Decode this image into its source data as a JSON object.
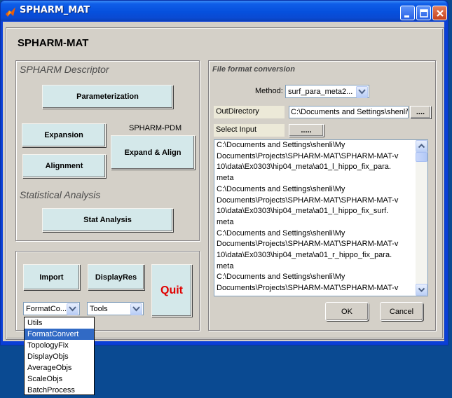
{
  "window": {
    "title": "SPHARM_MAT"
  },
  "main_title": "SPHARM-MAT",
  "descriptor_panel": {
    "title": "SPHARM Descriptor",
    "parameterization": "Parameterization",
    "expansion": "Expansion",
    "alignment": "Alignment",
    "pdm_label": "SPHARM-PDM",
    "expand_align": "Expand & Align",
    "stat_title": "Statistical Analysis",
    "stat_analysis": "Stat Analysis"
  },
  "bottom_panel": {
    "import": "Import",
    "display_res": "DisplayRes",
    "quit": "Quit",
    "combo1_value": "FormatCo...",
    "combo2_value": "Tools"
  },
  "dropdown": {
    "items": [
      "Utils",
      "FormatConvert",
      "TopologyFix",
      "DisplayObjs",
      "AverageObjs",
      "ScaleObjs",
      "BatchProcess"
    ],
    "selected": "FormatConvert"
  },
  "format_panel": {
    "title": "File format conversion",
    "method_label": "Method:",
    "method_value": "surf_para_meta2...",
    "outdir_label": "OutDirectory",
    "outdir_value": "C:\\Documents and Settings\\shenli\\M",
    "browse_label": "....",
    "select_input_label": "Select Input",
    "select_input_button": ".....",
    "list_lines": [
      "C:\\Documents and Settings\\shenli\\My",
      "Documents\\Projects\\SPHARM-MAT\\SPHARM-MAT-v",
      "10\\data\\Ex0303\\hip04_meta\\a01_l_hippo_fix_para.",
      "meta",
      "C:\\Documents and Settings\\shenli\\My",
      "Documents\\Projects\\SPHARM-MAT\\SPHARM-MAT-v",
      "10\\data\\Ex0303\\hip04_meta\\a01_l_hippo_fix_surf.",
      "meta",
      "C:\\Documents and Settings\\shenli\\My",
      "Documents\\Projects\\SPHARM-MAT\\SPHARM-MAT-v",
      "10\\data\\Ex0303\\hip04_meta\\a01_r_hippo_fix_para.",
      "meta",
      "C:\\Documents and Settings\\shenli\\My",
      "Documents\\Projects\\SPHARM-MAT\\SPHARM-MAT-v"
    ],
    "ok": "OK",
    "cancel": "Cancel"
  },
  "colors": {
    "quit_text": "#e00000",
    "selection": "#316ac5",
    "button_face": "#d4e8ea"
  }
}
